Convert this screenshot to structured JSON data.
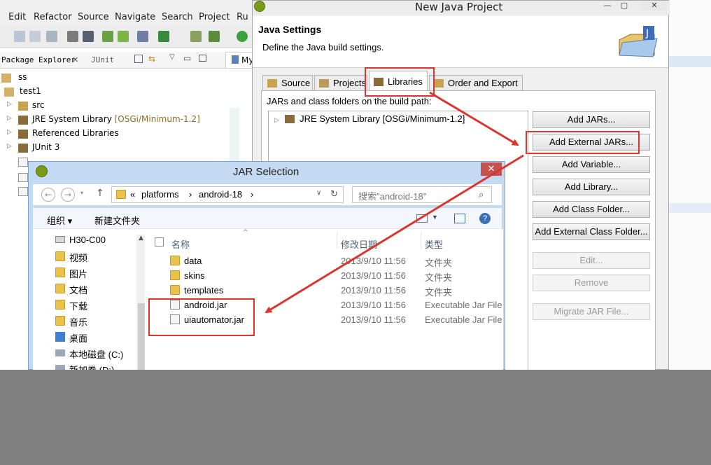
{
  "eclipse": {
    "menu": [
      "Edit",
      "Refactor",
      "Source",
      "Navigate",
      "Search",
      "Project"
    ],
    "menu_partial": "Ru",
    "views": {
      "package_explorer": "Package Explorer",
      "junit": "JUnit"
    },
    "editor_tab": "My",
    "tree": {
      "ss": "ss",
      "test1": "test1",
      "src": "src",
      "jre_name": "JRE System Library",
      "jre_suffix": "[OSGi/Minimum-1.2]",
      "referenced": "Referenced Libraries",
      "junit": "JUnit 3"
    }
  },
  "new_java_project": {
    "title": "New Java Project",
    "heading": "Java Settings",
    "subheading": "Define the Java build settings.",
    "tabs": [
      "Source",
      "Projects",
      "Libraries",
      "Order and Export"
    ],
    "build_path_label": "JARs and class folders on the build path:",
    "build_path_item": "JRE System Library [OSGi/Minimum-1.2]",
    "buttons": {
      "add_jars": "Add JARs...",
      "add_external_jars": "Add External JARs...",
      "add_variable": "Add Variable...",
      "add_library": "Add Library...",
      "add_class_folder": "Add Class Folder...",
      "add_external_class_folder": "Add External Class Folder...",
      "edit": "Edit...",
      "remove": "Remove",
      "migrate": "Migrate JAR File..."
    }
  },
  "jar_selection": {
    "title": "JAR Selection",
    "close": "✕",
    "address": {
      "prefix": "«",
      "seg1": "platforms",
      "sep": "›",
      "seg2": "android-18"
    },
    "search_placeholder": "搜索\"android-18\"",
    "commands": {
      "organize": "组织 ▾",
      "new_folder": "新建文件夹"
    },
    "nav_items": [
      "H30-C00",
      "视频",
      "图片",
      "文档",
      "下载",
      "音乐",
      "桌面",
      "本地磁盘 (C:)",
      "新加卷 (D:)"
    ],
    "columns": {
      "name": "名称",
      "date": "修改日期",
      "type": "类型"
    },
    "files": [
      {
        "name": "data",
        "date": "2013/9/10 11:56",
        "type": "文件夹",
        "kind": "folder"
      },
      {
        "name": "skins",
        "date": "2013/9/10 11:56",
        "type": "文件夹",
        "kind": "folder"
      },
      {
        "name": "templates",
        "date": "2013/9/10 11:56",
        "type": "文件夹",
        "kind": "folder"
      },
      {
        "name": "android.jar",
        "date": "2013/9/10 11:56",
        "type": "Executable Jar File",
        "kind": "jar"
      },
      {
        "name": "uiautomator.jar",
        "date": "2013/9/10 11:56",
        "type": "Executable Jar File",
        "kind": "jar"
      }
    ]
  },
  "annotation_color": "#d9362f"
}
